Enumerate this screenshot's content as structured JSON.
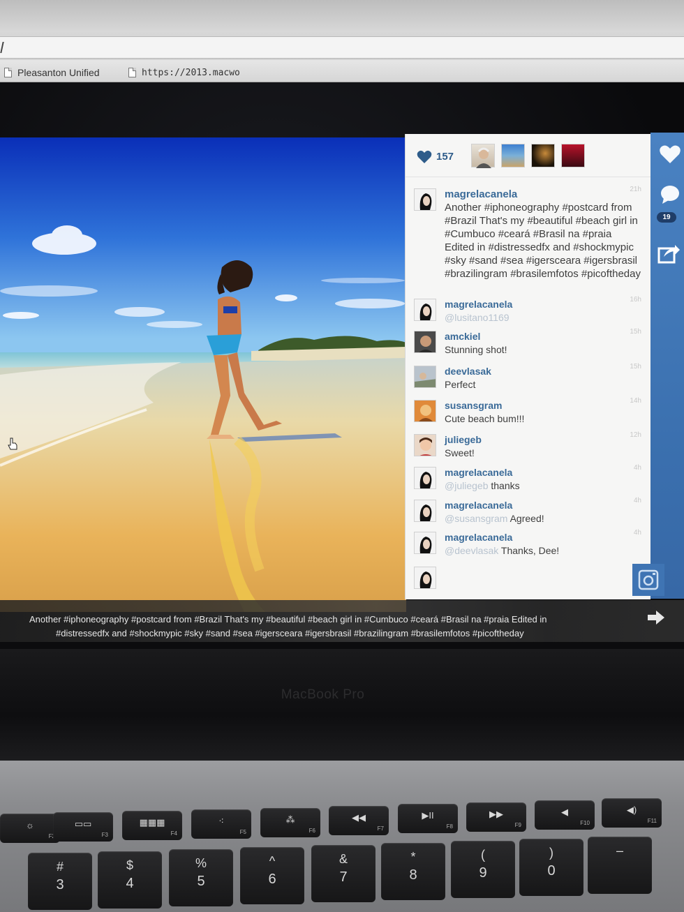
{
  "browser": {
    "bookmarks": [
      {
        "label": "Pleasanton Unified"
      },
      {
        "label": "https://2013.macwo"
      }
    ]
  },
  "post": {
    "likes_count": "157",
    "caption_user": "magrelacanela",
    "caption_time": "21h",
    "caption_text": "Another #iphoneography #postcard from #Brazil That's my #beautiful #beach girl in #Cumbuco #ceará #Brasil na #praia Edited in #distressedfx and #shockmypic #sky #sand #sea #igersceara #igersbrasil #brazilingram #brasilemfotos #picoftheday",
    "comments": [
      {
        "user": "magrelacanela",
        "mention": "@lusitano1169",
        "text": " ",
        "time": "16h"
      },
      {
        "user": "amckiel",
        "mention": "",
        "text": "Stunning shot!",
        "time": "15h"
      },
      {
        "user": "deevlasak",
        "mention": "",
        "text": "Perfect",
        "time": "15h"
      },
      {
        "user": "susansgram",
        "mention": "",
        "text": "Cute beach bum!!!",
        "time": "14h"
      },
      {
        "user": "juliegeb",
        "mention": "",
        "text": "Sweet!",
        "time": "12h"
      },
      {
        "user": "magrelacanela",
        "mention": "@juliegeb",
        "text": " thanks",
        "time": "4h"
      },
      {
        "user": "magrelacanela",
        "mention": "@susansgram",
        "text": " Agreed!",
        "time": "4h"
      },
      {
        "user": "magrelacanela",
        "mention": "@deevlasak",
        "text": " Thanks, Dee!",
        "time": "4h"
      }
    ],
    "comment_count_badge": "19",
    "bottom_caption_line1": "Another #iphoneography #postcard from #Brazil That's my #beautiful #beach girl in #Cumbuco #ceará #Brasil na #praia Edited in",
    "bottom_caption_line2": "#distressedfx and #shockmypic #sky #sand #sea #igersceara #igersbrasil #brazilingram #brasilemfotos #picoftheday"
  },
  "laptop": {
    "label": "MacBook Pro",
    "fkeys": [
      {
        "glyph": "☼",
        "fn": "F2"
      },
      {
        "glyph": "▭▭",
        "fn": "F3"
      },
      {
        "glyph": "▦▦▦",
        "fn": "F4"
      },
      {
        "glyph": "⁖",
        "fn": "F5"
      },
      {
        "glyph": "⁂",
        "fn": "F6"
      },
      {
        "glyph": "◀◀",
        "fn": "F7"
      },
      {
        "glyph": "▶II",
        "fn": "F8"
      },
      {
        "glyph": "▶▶",
        "fn": "F9"
      },
      {
        "glyph": "◀",
        "fn": "F10"
      },
      {
        "glyph": "◀)",
        "fn": "F11"
      }
    ],
    "numkeys": [
      {
        "top": "#",
        "bot": "3"
      },
      {
        "top": "$",
        "bot": "4"
      },
      {
        "top": "%",
        "bot": "5"
      },
      {
        "top": "^",
        "bot": "6"
      },
      {
        "top": "&",
        "bot": "7"
      },
      {
        "top": "*",
        "bot": "8"
      },
      {
        "top": "(",
        "bot": "9"
      },
      {
        "top": ")",
        "bot": "0"
      },
      {
        "top": "–",
        "bot": ""
      }
    ]
  },
  "colors": {
    "accent": "#3a6fae",
    "username": "#3a6a98",
    "like_heart": "#2e5c8a"
  }
}
